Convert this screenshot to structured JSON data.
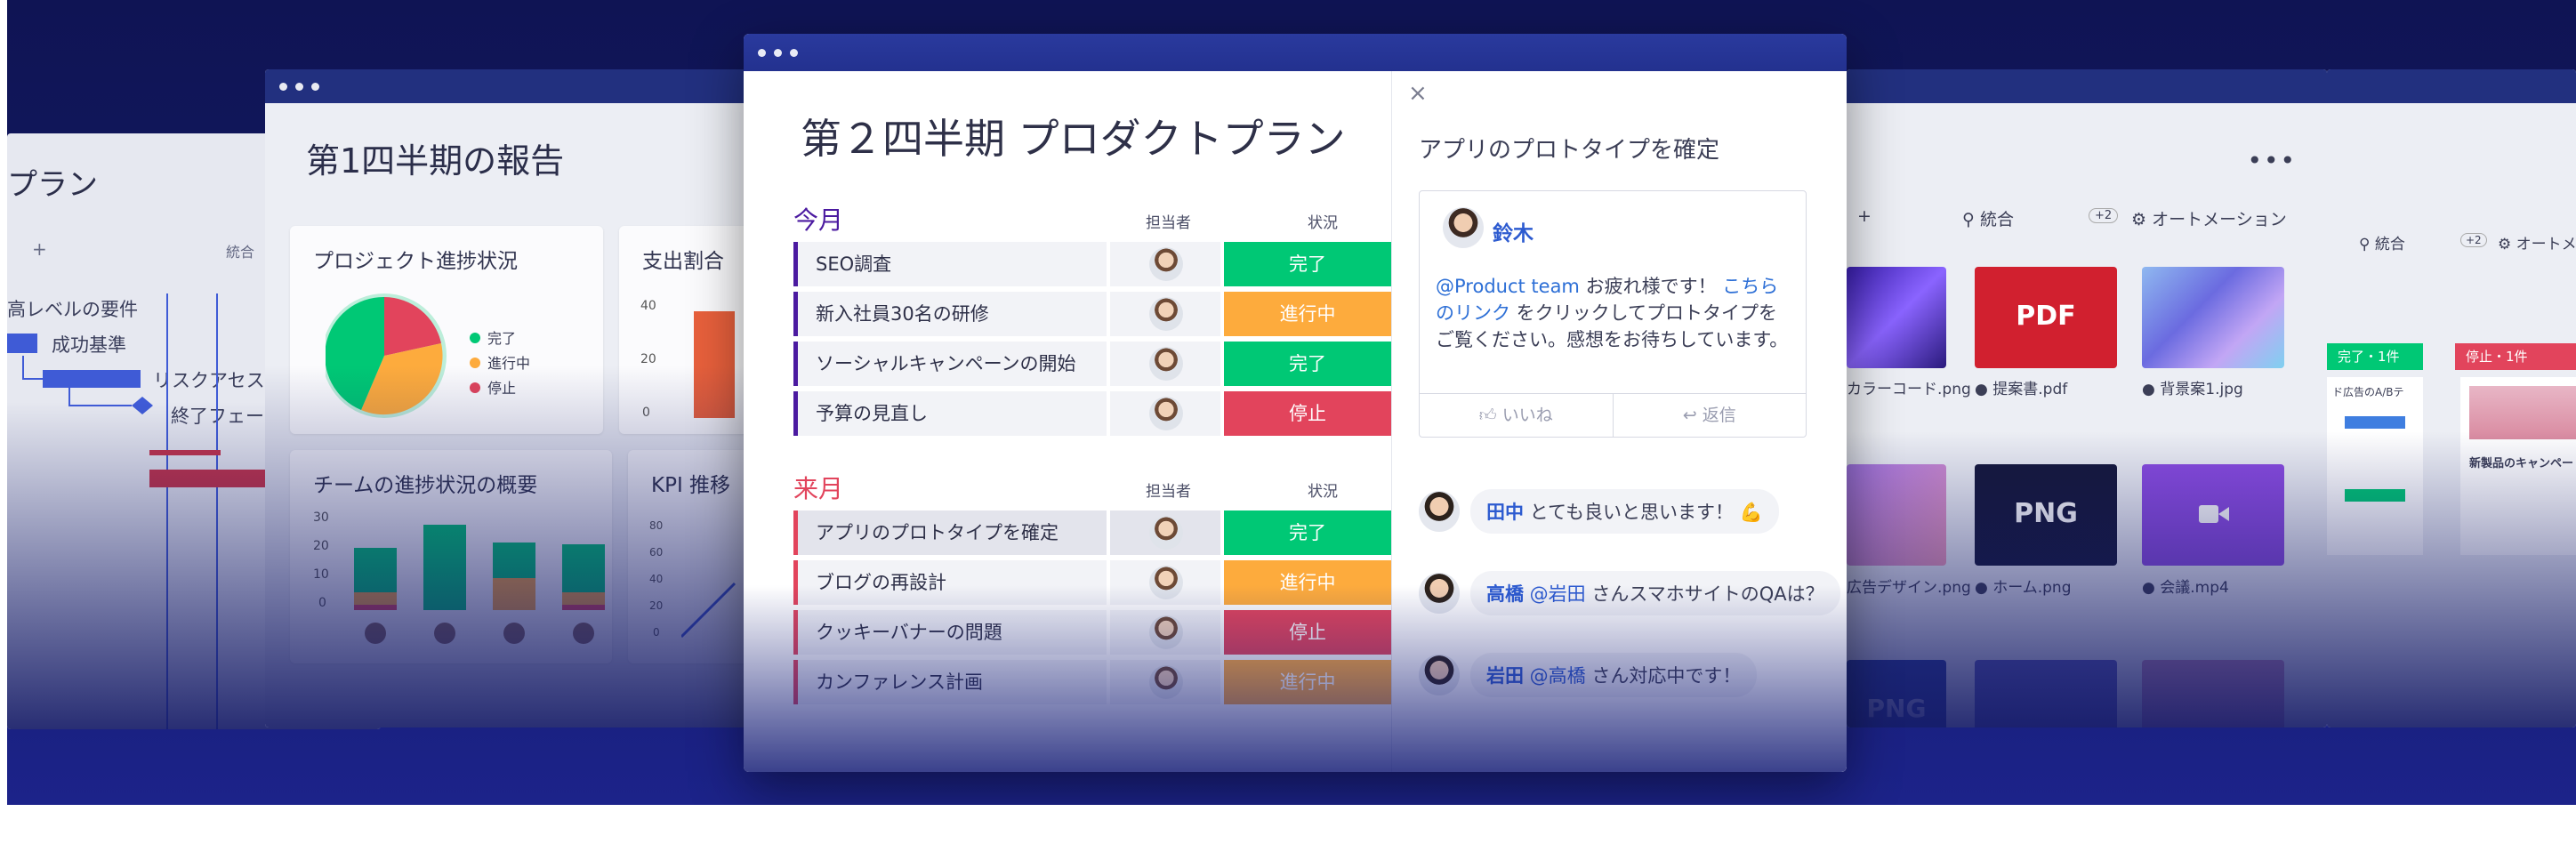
{
  "colors": {
    "done": "#00c875",
    "working": "#fdab3d",
    "stuck": "#e2445c",
    "this_month_accent": "#4b1aa0",
    "next_month_accent": "#e2445c",
    "link": "#2d5bd0",
    "window_bar": "#283593"
  },
  "left_window": {
    "title": "プラン",
    "items": [
      "高レベルの要件",
      "成功基準",
      "リスクアセス",
      "終了フェー"
    ],
    "toolbar_plus": "+",
    "toolbar_tab": "統合"
  },
  "q1_window": {
    "title": "第1四半期の報告",
    "progress_card": {
      "title": "プロジェクト進捗状況",
      "legend": [
        "完了",
        "進行中",
        "停止"
      ]
    },
    "expense_card": {
      "title": "支出割合",
      "ticks": [
        "40",
        "20",
        "0"
      ]
    },
    "team_card": {
      "title": "チームの進捗状況の概要",
      "ticks": [
        "30",
        "20",
        "10",
        "0"
      ]
    },
    "kpi_card": {
      "title": "KPI 推移",
      "ticks": [
        "80",
        "60",
        "40",
        "20",
        "0"
      ]
    }
  },
  "main_window": {
    "title": "第２四半期 プロダクトプラン",
    "this_month": {
      "label": "今月",
      "col_owner": "担当者",
      "col_status": "状況",
      "rows": [
        {
          "name": "SEO調査",
          "status": "完了"
        },
        {
          "name": "新入社員30名の研修",
          "status": "進行中"
        },
        {
          "name": "ソーシャルキャンペーンの開始",
          "status": "完了"
        },
        {
          "name": "予算の見直し",
          "status": "停止"
        }
      ]
    },
    "next_month": {
      "label": "来月",
      "col_owner": "担当者",
      "col_status": "状況",
      "rows": [
        {
          "name": "アプリのプロトタイプを確定",
          "status": "完了"
        },
        {
          "name": "ブログの再設計",
          "status": "進行中"
        },
        {
          "name": "クッキーバナーの問題",
          "status": "停止"
        },
        {
          "name": "カンファレンス計画",
          "status": "進行中"
        }
      ]
    }
  },
  "update_panel": {
    "close": "×",
    "title": "アプリのプロトタイプを確定",
    "post": {
      "author": "鈴木",
      "mention": "@Product team",
      "text_1": " お疲れ様です！ ",
      "link": "こちらのリンク",
      "text_2": " をクリックしてプロトタイプをご覧ください。感想をお待ちしています。",
      "like": "いいね",
      "reply": "返信"
    },
    "replies": [
      {
        "name": "田中",
        "mention": "",
        "text": " とても良いと思います！ 💪"
      },
      {
        "name": "高橋",
        "mention": " @岩田",
        "text": " さんスマホサイトのQAは？"
      },
      {
        "name": "岩田",
        "mention": " @高橋",
        "text": " さん対応中です！"
      }
    ]
  },
  "files_window": {
    "toolbar": {
      "plus": "+",
      "integrations": "統合",
      "badge": "+2",
      "automations": "オートメーション"
    },
    "files": [
      {
        "name": "カラーコード.png",
        "tile_text": ""
      },
      {
        "name": "提案書.pdf",
        "tile_text": "PDF"
      },
      {
        "name": "背景案1.jpg",
        "tile_text": ""
      },
      {
        "name": "広告デザイン.png",
        "tile_text": ""
      },
      {
        "name": "ホーム.png",
        "tile_text": "PNG"
      },
      {
        "name": "会議.mp4",
        "tile_text": ""
      },
      {
        "name": "",
        "tile_text": "PNG"
      }
    ]
  },
  "far_right_window": {
    "toolbar": {
      "integrations": "統合",
      "badge": "+2",
      "automations": "オートメ"
    },
    "columns": [
      "完了・1件",
      "停止・1件"
    ],
    "card_1": "ド広告のA/Bテ",
    "card_2": "新製品のキャンペー"
  }
}
